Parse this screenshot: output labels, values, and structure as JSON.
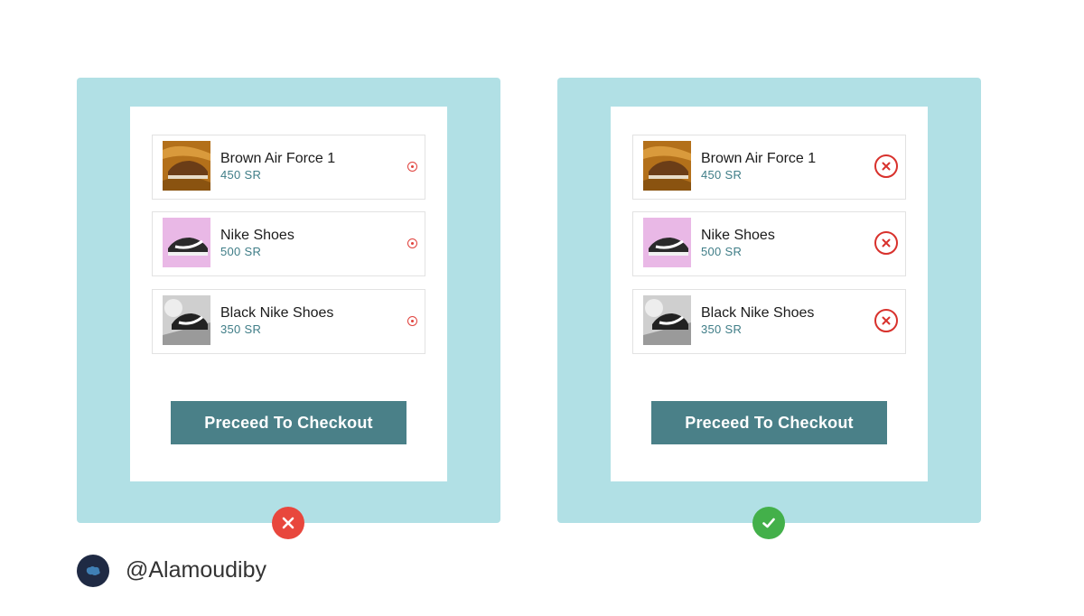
{
  "panels": {
    "left": {
      "items": [
        {
          "name": "Brown Air Force 1",
          "price": "450 SR",
          "thumb": "brown-sneaker"
        },
        {
          "name": "Nike Shoes",
          "price": "500 SR",
          "thumb": "black-white-sneaker-on-pink"
        },
        {
          "name": "Black Nike Shoes",
          "price": "350 SR",
          "thumb": "black-sneaker-grayscale"
        }
      ],
      "checkout_label": "Preceed To Checkout",
      "verdict": {
        "icon": "x-icon",
        "color": "#e8473d"
      }
    },
    "right": {
      "items": [
        {
          "name": "Brown Air Force 1",
          "price": "450 SR",
          "thumb": "brown-sneaker"
        },
        {
          "name": "Nike Shoes",
          "price": "500 SR",
          "thumb": "black-white-sneaker-on-pink"
        },
        {
          "name": "Black Nike Shoes",
          "price": "350 SR",
          "thumb": "black-sneaker-grayscale"
        }
      ],
      "checkout_label": "Preceed To Checkout",
      "verdict": {
        "icon": "checkmark-icon",
        "color": "#43b04a"
      }
    }
  },
  "footer": {
    "handle": "@Alamoudiby",
    "avatar_icon": "brain-icon"
  },
  "colors": {
    "panel_bg": "#b1e0e5",
    "button_bg": "#4a8088",
    "price_text": "#3f7d87",
    "remove_red": "#d8312c"
  }
}
